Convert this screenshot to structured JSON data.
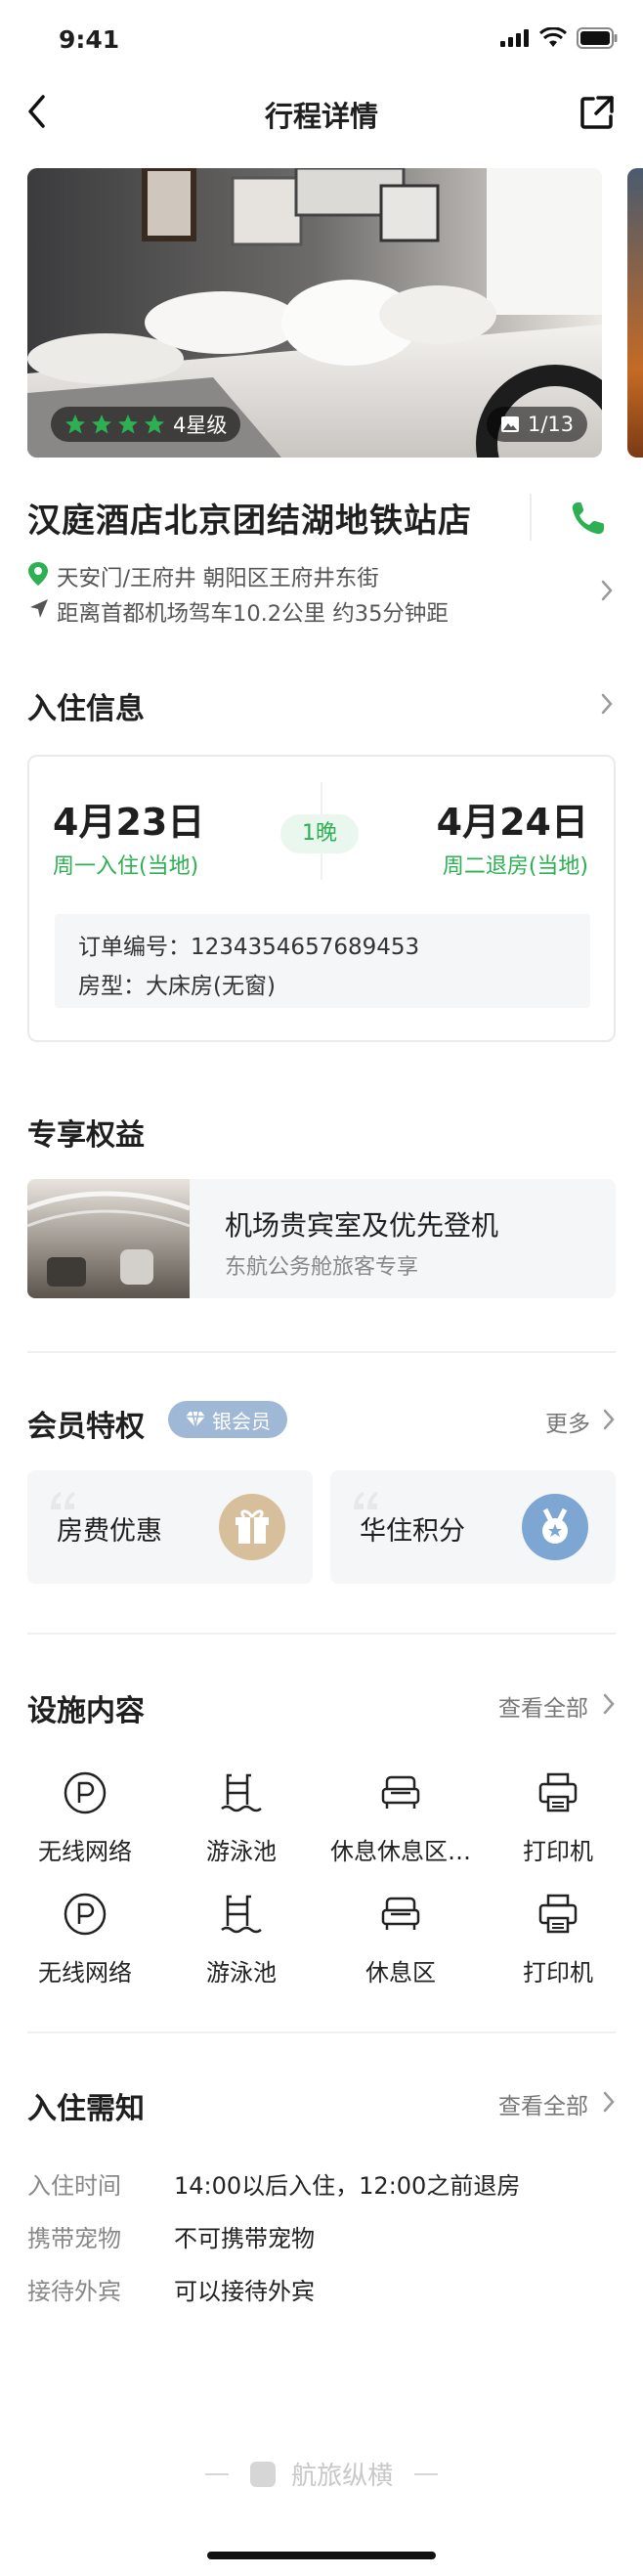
{
  "status_bar": {
    "time": "9:41"
  },
  "header": {
    "title": "行程详情"
  },
  "gallery": {
    "rating_label": "4星级",
    "stars": 4,
    "photo_counter": "1/13"
  },
  "hotel": {
    "name": "汉庭酒店北京团结湖地铁站店",
    "location": "天安门/王府井  朝阳区王府井东街",
    "distance": "距离首都机场驾车10.2公里 约35分钟距"
  },
  "checkin_info": {
    "title": "入住信息",
    "checkin_date": "4月23日",
    "checkin_sub": "周一入住(当地)",
    "nights": "1晚",
    "checkout_date": "4月24日",
    "checkout_sub": "周二退房(当地)",
    "order_number": "订单编号：1234354657689453",
    "room_type": "房型：大床房(无窗)"
  },
  "benefits": {
    "title": "专享权益",
    "item_title": "机场贵宾室及优先登机",
    "item_sub": "东航公务舱旅客专享"
  },
  "membership": {
    "title": "会员特权",
    "badge": "银会员",
    "more": "更多",
    "cards": [
      {
        "label": "房费优惠",
        "icon": "gift-icon",
        "color": "#d8bf9b"
      },
      {
        "label": "华住积分",
        "icon": "medal-icon",
        "color": "#7ea6d3"
      }
    ]
  },
  "facilities": {
    "title": "设施内容",
    "view_all": "查看全部",
    "items": [
      {
        "label": "无线网络",
        "icon": "parking-icon"
      },
      {
        "label": "游泳池",
        "icon": "pool-icon"
      },
      {
        "label": "休息休息区…",
        "icon": "sofa-icon"
      },
      {
        "label": "打印机",
        "icon": "printer-icon"
      },
      {
        "label": "无线网络",
        "icon": "parking-icon"
      },
      {
        "label": "游泳池",
        "icon": "pool-icon"
      },
      {
        "label": "休息区",
        "icon": "sofa-icon"
      },
      {
        "label": "打印机",
        "icon": "printer-icon"
      }
    ]
  },
  "notice": {
    "title": "入住需知",
    "view_all": "查看全部",
    "rows": [
      {
        "key": "入住时间",
        "value": "14:00以后入住，12:00之前退房"
      },
      {
        "key": "携带宠物",
        "value": "不可携带宠物"
      },
      {
        "key": "接待外宾",
        "value": "可以接待外宾"
      }
    ]
  },
  "footer": {
    "brand": "航旅纵横"
  },
  "colors": {
    "accent": "#2cb052",
    "silver_badge": "#9fb8d6"
  }
}
